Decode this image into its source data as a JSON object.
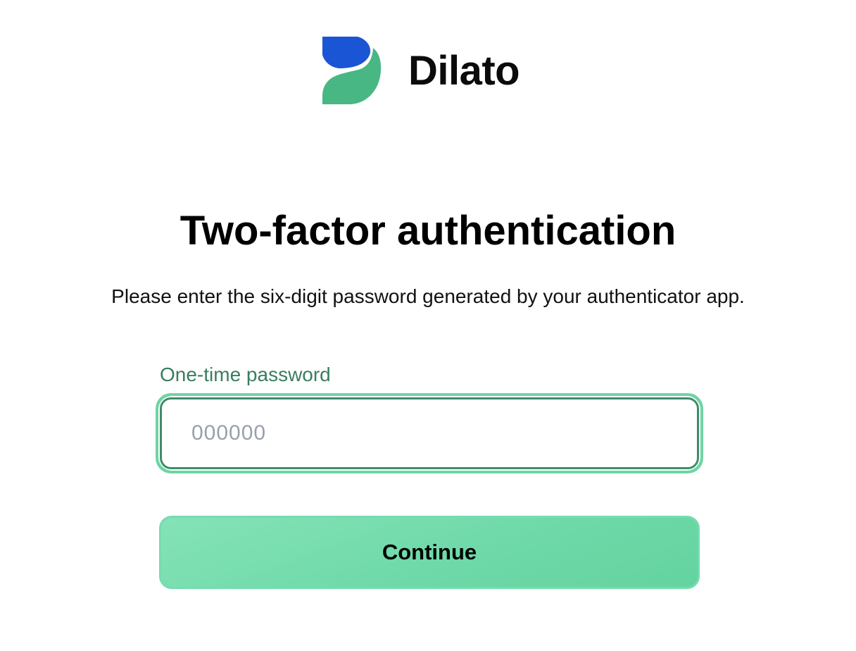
{
  "brand": {
    "name": "Dilato",
    "logo_icon": "dilato-logo-icon",
    "logo_colors": {
      "top": "#1a55d6",
      "bottom": "#48b784"
    }
  },
  "page": {
    "title": "Two-factor authentication",
    "subtitle": "Please enter the six-digit password generated by your authenticator app."
  },
  "otp_field": {
    "label": "One-time password",
    "value": "",
    "placeholder": "000000"
  },
  "actions": {
    "continue_label": "Continue"
  },
  "colors": {
    "accent": "#6fd4a4",
    "label": "#3a7d60",
    "input_border": "#3f8c6a",
    "button": "#70d9aa",
    "placeholder": "#9aa0ab"
  }
}
